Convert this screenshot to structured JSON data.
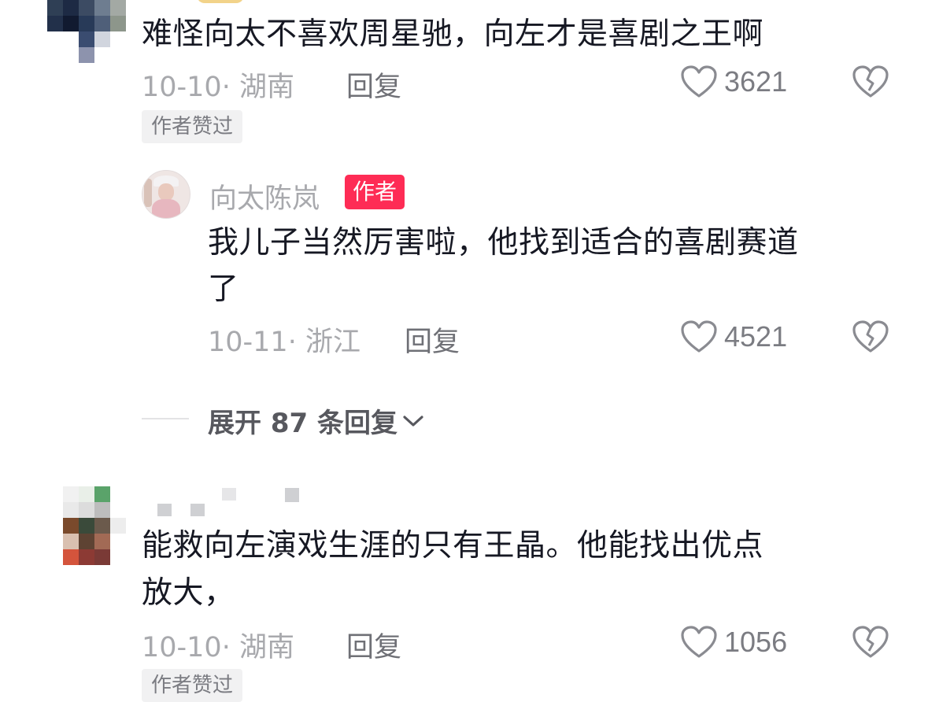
{
  "comments": [
    {
      "text": "难怪向太不喜欢周星驰，向左才是喜剧之王啊",
      "date_location": "10-10· 湖南",
      "reply_label": "回复",
      "likes": "3621",
      "liked_badge": "作者赞过",
      "reply": {
        "author": "向太陈岚",
        "author_tag": "作者",
        "text_line1": "我儿子当然厉害啦，他找到适合的喜剧赛道",
        "text_line2": "了",
        "date_location": "10-11· 浙江",
        "reply_label": "回复",
        "likes": "4521"
      },
      "expand_label": "展开 87 条回复"
    },
    {
      "text_line1": "能救向左演戏生涯的只有王晶。他能找出优点",
      "text_line2": "放大，",
      "date_location": "10-10· 湖南",
      "reply_label": "回复",
      "likes": "1056",
      "liked_badge": "作者赞过"
    }
  ],
  "colors": {
    "accent": "#fe2c55",
    "meta": "#a8a9ad",
    "text": "#161823"
  },
  "icons": {
    "like": "heart-outline-icon",
    "dislike": "broken-heart-icon",
    "expand": "chevron-down-icon"
  }
}
